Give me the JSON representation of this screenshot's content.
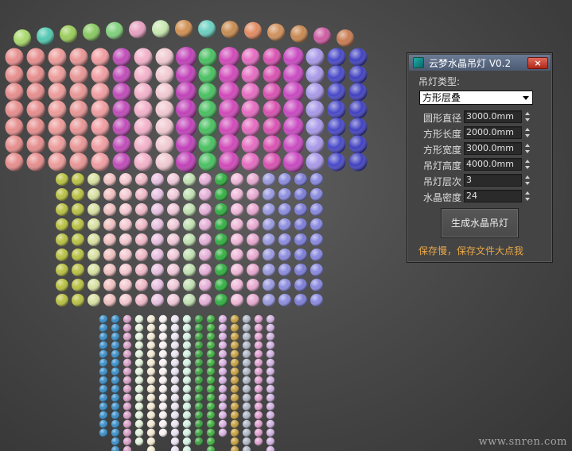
{
  "panel": {
    "title": "云梦水晶吊灯 V0.2",
    "close_label": "×",
    "type_label": "吊灯类型:",
    "type_value": "方形层叠",
    "params": [
      {
        "label": "圆形直径",
        "value": "3000.0mm"
      },
      {
        "label": "方形长度",
        "value": "2000.0mm"
      },
      {
        "label": "方形宽度",
        "value": "3000.0mm"
      },
      {
        "label": "吊灯高度",
        "value": "4000.0mm"
      },
      {
        "label": "吊灯层次",
        "value": "3"
      },
      {
        "label": "水晶密度",
        "value": "24"
      }
    ],
    "generate_label": "生成水晶吊灯",
    "note": "保存慢，保存文件大点我"
  },
  "watermark": "www.snren.com",
  "viewport": {
    "description_icon": "crystal-chandelier-3d-model",
    "background_color": "#4a4a4a"
  }
}
